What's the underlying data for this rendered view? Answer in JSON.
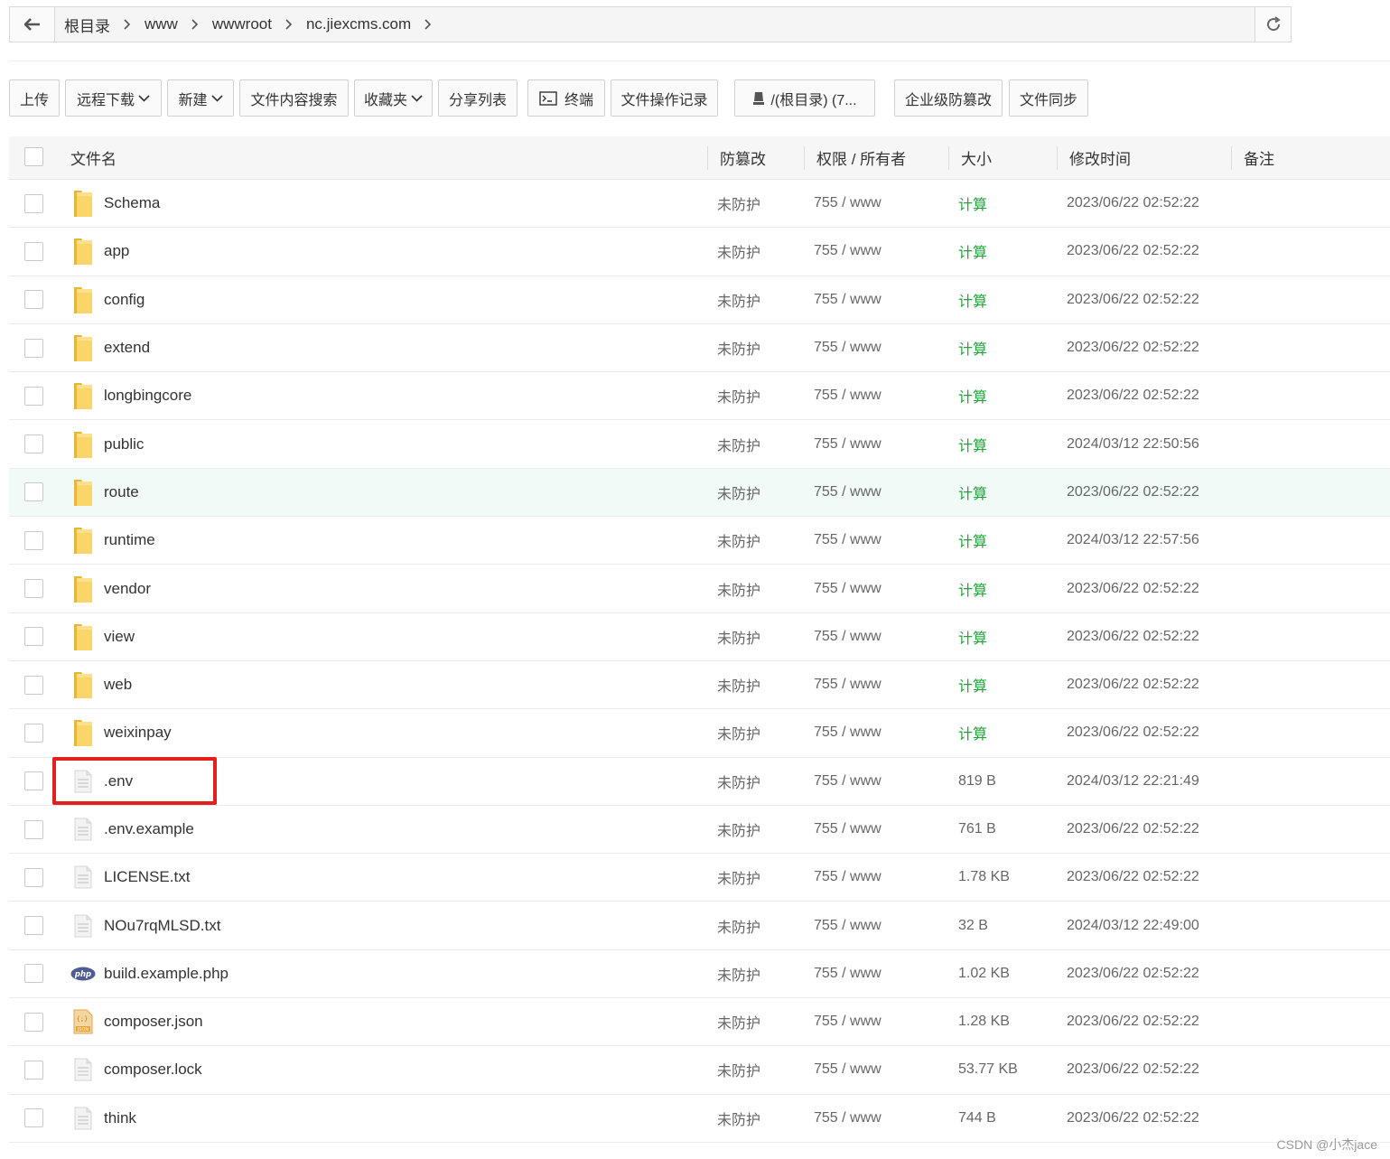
{
  "pathbar": {
    "crumbs": [
      "根目录",
      "www",
      "wwwroot",
      "nc.jiexcms.com"
    ]
  },
  "toolbar": {
    "upload": "上传",
    "remote_download": "远程下载",
    "new": "新建",
    "content_search": "文件内容搜索",
    "favorites": "收藏夹",
    "share_list": "分享列表",
    "terminal": "终端",
    "op_log": "文件操作记录",
    "disk": "/(根目录) (7...",
    "tamper": "企业级防篡改",
    "sync": "文件同步"
  },
  "table": {
    "headers": {
      "name": "文件名",
      "guard": "防篡改",
      "perm": "权限 / 所有者",
      "size": "大小",
      "mtime": "修改时间",
      "note": "备注"
    },
    "rows": [
      {
        "name": "Schema",
        "icon": "folder-icon",
        "guard": "未防护",
        "perm": "755 / www",
        "size": "计算",
        "mtime": "2023/06/22 02:52:22"
      },
      {
        "name": "app",
        "icon": "folder-icon",
        "guard": "未防护",
        "perm": "755 / www",
        "size": "计算",
        "mtime": "2023/06/22 02:52:22"
      },
      {
        "name": "config",
        "icon": "folder-icon",
        "guard": "未防护",
        "perm": "755 / www",
        "size": "计算",
        "mtime": "2023/06/22 02:52:22"
      },
      {
        "name": "extend",
        "icon": "folder-icon",
        "guard": "未防护",
        "perm": "755 / www",
        "size": "计算",
        "mtime": "2023/06/22 02:52:22"
      },
      {
        "name": "longbingcore",
        "icon": "folder-icon",
        "guard": "未防护",
        "perm": "755 / www",
        "size": "计算",
        "mtime": "2023/06/22 02:52:22"
      },
      {
        "name": "public",
        "icon": "folder-icon",
        "guard": "未防护",
        "perm": "755 / www",
        "size": "计算",
        "mtime": "2024/03/12 22:50:56"
      },
      {
        "name": "route",
        "icon": "folder-icon",
        "guard": "未防护",
        "perm": "755 / www",
        "size": "计算",
        "mtime": "2023/06/22 02:52:22"
      },
      {
        "name": "runtime",
        "icon": "folder-icon",
        "guard": "未防护",
        "perm": "755 / www",
        "size": "计算",
        "mtime": "2024/03/12 22:57:56"
      },
      {
        "name": "vendor",
        "icon": "folder-icon",
        "guard": "未防护",
        "perm": "755 / www",
        "size": "计算",
        "mtime": "2023/06/22 02:52:22"
      },
      {
        "name": "view",
        "icon": "folder-icon",
        "guard": "未防护",
        "perm": "755 / www",
        "size": "计算",
        "mtime": "2023/06/22 02:52:22"
      },
      {
        "name": "web",
        "icon": "folder-icon",
        "guard": "未防护",
        "perm": "755 / www",
        "size": "计算",
        "mtime": "2023/06/22 02:52:22"
      },
      {
        "name": "weixinpay",
        "icon": "folder-icon",
        "guard": "未防护",
        "perm": "755 / www",
        "size": "计算",
        "mtime": "2023/06/22 02:52:22"
      },
      {
        "name": ".env",
        "icon": "file-icon",
        "guard": "未防护",
        "perm": "755 / www",
        "size": "819 B",
        "mtime": "2024/03/12 22:21:49"
      },
      {
        "name": ".env.example",
        "icon": "file-icon",
        "guard": "未防护",
        "perm": "755 / www",
        "size": "761 B",
        "mtime": "2023/06/22 02:52:22"
      },
      {
        "name": "LICENSE.txt",
        "icon": "file-icon",
        "guard": "未防护",
        "perm": "755 / www",
        "size": "1.78 KB",
        "mtime": "2023/06/22 02:52:22"
      },
      {
        "name": "NOu7rqMLSD.txt",
        "icon": "file-icon",
        "guard": "未防护",
        "perm": "755 / www",
        "size": "32 B",
        "mtime": "2024/03/12 22:49:00"
      },
      {
        "name": "build.example.php",
        "icon": "php-icon",
        "guard": "未防护",
        "perm": "755 / www",
        "size": "1.02 KB",
        "mtime": "2023/06/22 02:52:22"
      },
      {
        "name": "composer.json",
        "icon": "json-icon",
        "guard": "未防护",
        "perm": "755 / www",
        "size": "1.28 KB",
        "mtime": "2023/06/22 02:52:22"
      },
      {
        "name": "composer.lock",
        "icon": "file-icon",
        "guard": "未防护",
        "perm": "755 / www",
        "size": "53.77 KB",
        "mtime": "2023/06/22 02:52:22"
      },
      {
        "name": "think",
        "icon": "file-icon",
        "guard": "未防护",
        "perm": "755 / www",
        "size": "744 B",
        "mtime": "2023/06/22 02:52:22"
      }
    ]
  },
  "colors": {
    "calc_green": "#20a53a",
    "highlight_box": "#e3201d",
    "hover_row": "#f2faf8",
    "folder_yellow": "#f7c948"
  },
  "watermark": "CSDN @小杰jace"
}
